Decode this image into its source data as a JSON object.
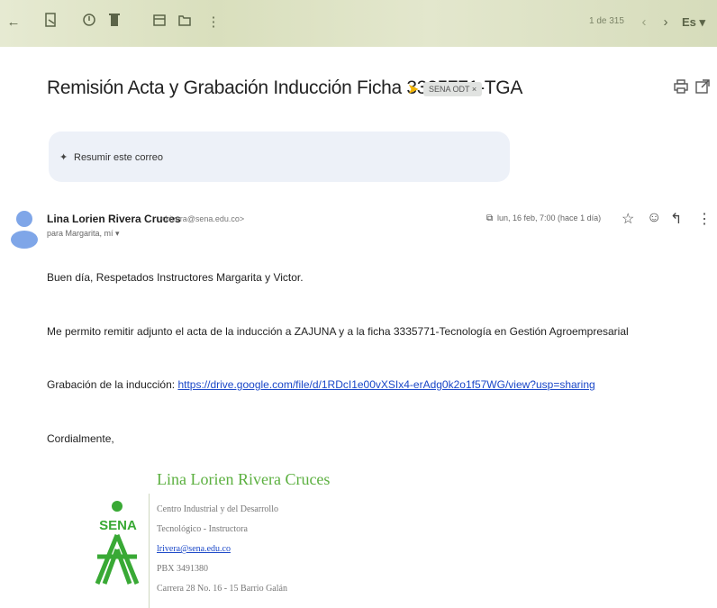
{
  "toolbar": {
    "icons": [
      "back-arrow-icon",
      "archive-icon",
      "report-spam-icon",
      "delete-icon",
      "mark-unread-icon",
      "move-to-icon",
      "more-vert-icon"
    ],
    "pagination": "1 de 315",
    "prev_icon": "chevron-left-icon",
    "next_icon": "chevron-right-icon",
    "input_tools": "Es ▾"
  },
  "email": {
    "subject": "Remisión Acta y Grabación Inducción Ficha 3335771-TGA",
    "label": "SENA ODT ×",
    "summary_label": "Resumir este correo",
    "sender_name": "Lina Lorien Rivera Cruces",
    "sender_email": "<lrivera@sena.edu.co>",
    "recipients": "para Margarita, mí ▾",
    "date": "lun, 16 feb, 7:00 (hace 1 día)",
    "body": {
      "greeting": "Buen día, Respetados Instructores Margarita y Victor.",
      "paragraph1": "Me permito remitir adjunto el acta de la inducción a ZAJUNA y a la ficha 3335771-Tecnología en Gestión Agroempresarial",
      "recording_label": "Grabación de la inducción: ",
      "recording_link": "https://drive.google.com/file/d/1RDcI1e00vXSIx4-erAdg0k2o1f57WG/view?usp=sharing",
      "closing": "Cordialmente,"
    },
    "signature": {
      "name": "Lina Lorien Rivera Cruces",
      "line1": "Centro Industrial y del Desarrollo",
      "line2": "Tecnológico - Instructora",
      "email": "lrivera@sena.edu.co",
      "phone": "PBX 3491380",
      "address": "Carrera 28 No. 16 - 15 Barrio Galán",
      "logo_text": "SENA"
    }
  }
}
